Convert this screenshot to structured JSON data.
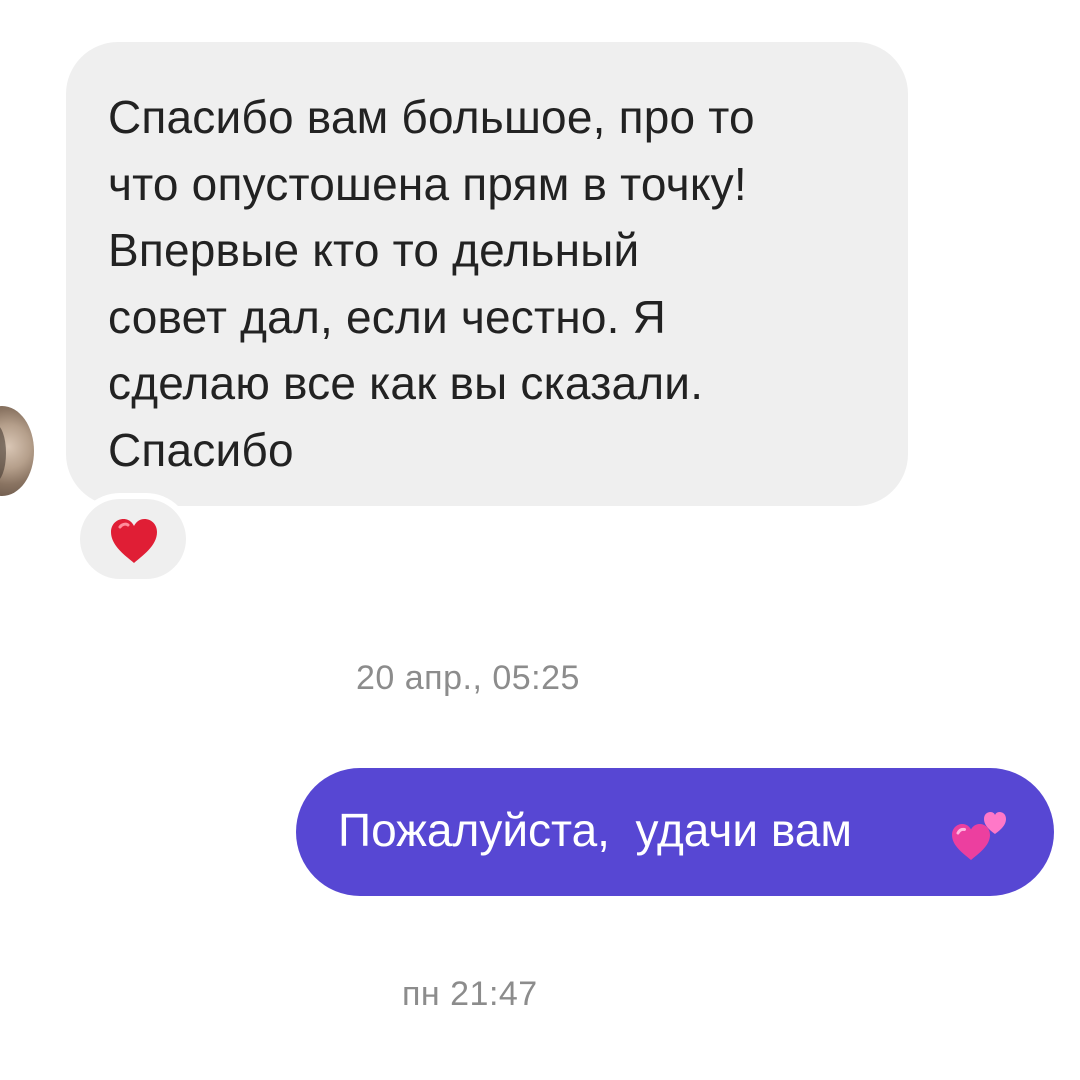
{
  "conversation": {
    "incoming": {
      "text": "Спасибо вам большое, про то\nчто опустошена прям в точку!\nВпервые кто то дельный\nсовет дал, если честно. Я\nсделаю все как вы сказали.\nСпасибо",
      "reaction_icon": "red-heart-icon"
    },
    "timestamp_1": "20 апр., 05:25",
    "outgoing": {
      "text": "Пожалуйста,  удачи вам",
      "emoji_icon": "two-hearts-icon",
      "bubble_color": "#5747d3"
    },
    "timestamp_2": "пн 21:47"
  },
  "colors": {
    "incoming_bubble": "#efefef",
    "incoming_text": "#222222",
    "timestamp": "#8c8c8c",
    "background": "#ffffff",
    "reaction_heart": "#e01e35",
    "emoji_hearts": "#ff4fb8"
  }
}
